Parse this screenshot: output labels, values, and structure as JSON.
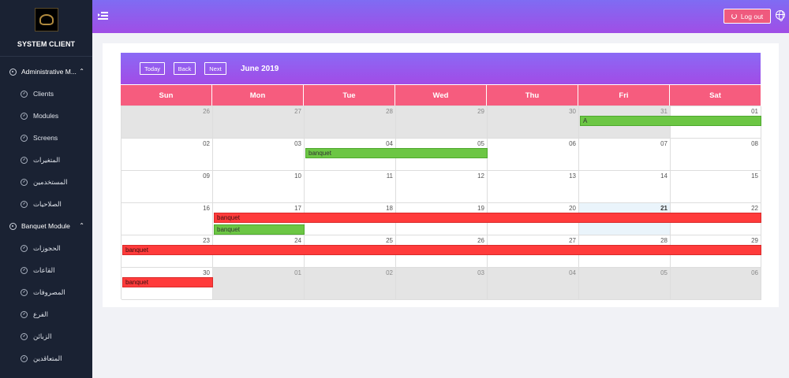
{
  "app": {
    "brand": "SYSTEM CLIENT"
  },
  "sidebar": {
    "groups": [
      {
        "label": "Administrative M...",
        "items": [
          "Clients",
          "Modules",
          "Screens",
          "المتغيرات",
          "المستخدمين",
          "الصلاحيات"
        ]
      },
      {
        "label": "Banquet Module",
        "items": [
          "الحجوزات",
          "القاعات",
          "المصروفات",
          "الفرع",
          "الزبائن",
          "المتعاقدين"
        ]
      }
    ]
  },
  "topbar": {
    "logout_label": "Log out"
  },
  "calendar": {
    "buttons": {
      "today": "Today",
      "back": "Back",
      "next": "Next"
    },
    "title": "June 2019",
    "weekdays": [
      "Sun",
      "Mon",
      "Tue",
      "Wed",
      "Thu",
      "Fri",
      "Sat"
    ],
    "weeks": [
      [
        "26",
        "27",
        "28",
        "29",
        "30",
        "31",
        "01"
      ],
      [
        "02",
        "03",
        "04",
        "05",
        "06",
        "07",
        "08"
      ],
      [
        "09",
        "10",
        "11",
        "12",
        "13",
        "14",
        "15"
      ],
      [
        "16",
        "17",
        "18",
        "19",
        "20",
        "21",
        "22"
      ],
      [
        "23",
        "24",
        "25",
        "26",
        "27",
        "28",
        "29"
      ],
      [
        "30",
        "01",
        "02",
        "03",
        "04",
        "05",
        "06"
      ]
    ],
    "events": [
      {
        "title": "A",
        "start": "2019-05-31",
        "end": "2019-06-01",
        "color": "#6cc644"
      },
      {
        "title": "banquet",
        "start": "2019-06-04",
        "end": "2019-06-05",
        "color": "#6cc644"
      },
      {
        "title": "banquet",
        "start": "2019-06-17",
        "end": "2019-06-22",
        "color": "#ff3b3b"
      },
      {
        "title": "banquet",
        "start": "2019-06-17",
        "end": "2019-06-17",
        "color": "#6cc644"
      },
      {
        "title": "banquet",
        "start": "2019-06-23",
        "end": "2019-06-29",
        "color": "#ff3b3b"
      },
      {
        "title": "banquet",
        "start": "2019-06-30",
        "end": "2019-06-30",
        "color": "#ff3b3b"
      }
    ],
    "today": "21"
  }
}
